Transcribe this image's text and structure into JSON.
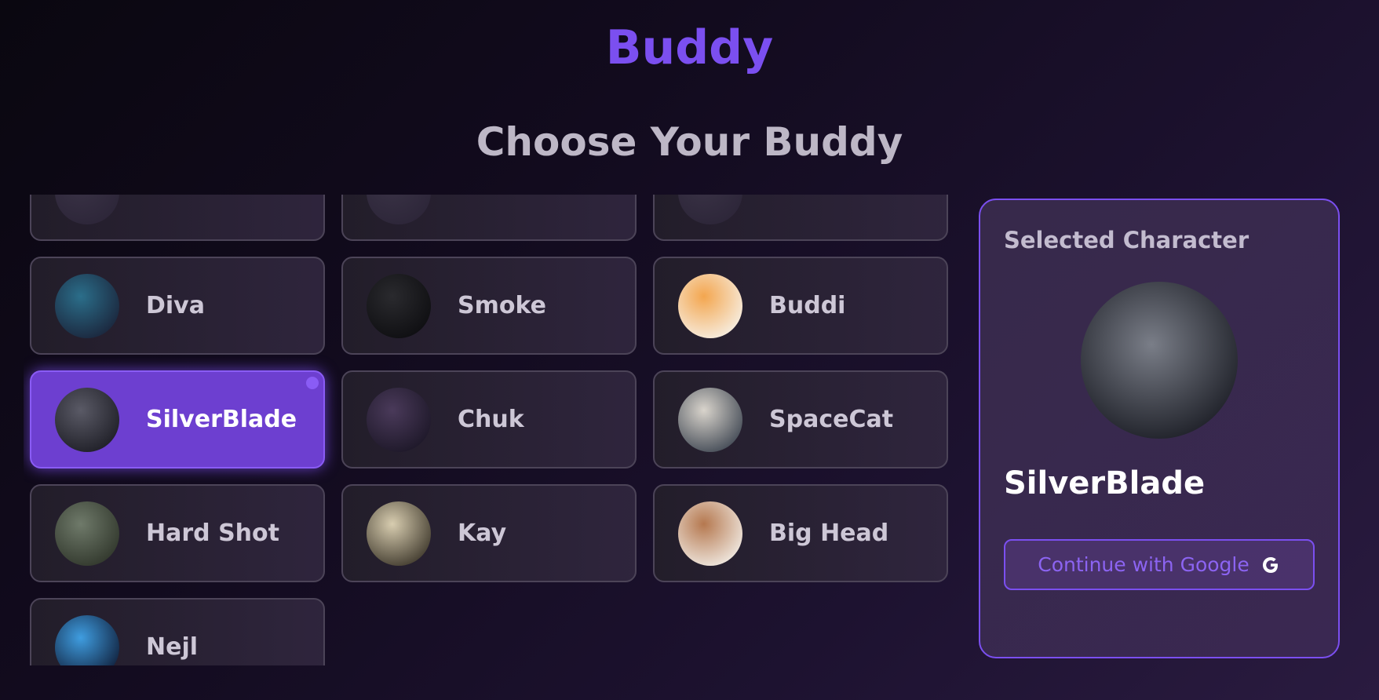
{
  "app": {
    "title": "Buddy",
    "accent_color": "#7b4ff0"
  },
  "page": {
    "heading": "Choose Your Buddy"
  },
  "characters": [
    {
      "label": "",
      "icon": "character-avatar",
      "colors": [
        "#3a3346",
        "#2c2538"
      ]
    },
    {
      "label": "",
      "icon": "character-avatar",
      "colors": [
        "#3a3346",
        "#2c2538"
      ]
    },
    {
      "label": "",
      "icon": "character-avatar",
      "colors": [
        "#3a3346",
        "#2c2538"
      ]
    },
    {
      "label": "Diva",
      "icon": "diva-avatar",
      "colors": [
        "#2b6e8a",
        "#1a2238"
      ]
    },
    {
      "label": "Smoke",
      "icon": "smoke-avatar",
      "colors": [
        "#2a2a2e",
        "#0d0d10"
      ]
    },
    {
      "label": "Buddi",
      "icon": "buddi-avatar",
      "colors": [
        "#f3a64f",
        "#f7f2ea"
      ]
    },
    {
      "label": "SilverBlade",
      "icon": "silverblade-avatar",
      "colors": [
        "#5a5a66",
        "#1c1c24"
      ],
      "selected": true
    },
    {
      "label": "Chuk",
      "icon": "chuk-avatar",
      "colors": [
        "#4a3a5a",
        "#1b1626"
      ]
    },
    {
      "label": "SpaceCat",
      "icon": "spacecat-avatar",
      "colors": [
        "#d9d4cc",
        "#3c4450"
      ]
    },
    {
      "label": "Hard Shot",
      "icon": "hard-shot-avatar",
      "colors": [
        "#6f7a6a",
        "#2e3429"
      ]
    },
    {
      "label": "Kay",
      "icon": "kay-avatar",
      "colors": [
        "#d8cdb0",
        "#3a3428"
      ]
    },
    {
      "label": "Big Head",
      "icon": "big-head-avatar",
      "colors": [
        "#b5784f",
        "#f3efe9"
      ]
    },
    {
      "label": "Nejl",
      "icon": "nejl-avatar",
      "colors": [
        "#3f9de0",
        "#0e1a34"
      ]
    }
  ],
  "selected_panel": {
    "title": "Selected Character",
    "name": "SilverBlade",
    "avatar_icon": "silverblade-portrait",
    "avatar_colors": [
      "#7a7e88",
      "#1d1f27"
    ],
    "button_label": "Continue with Google",
    "button_icon": "google-icon"
  }
}
